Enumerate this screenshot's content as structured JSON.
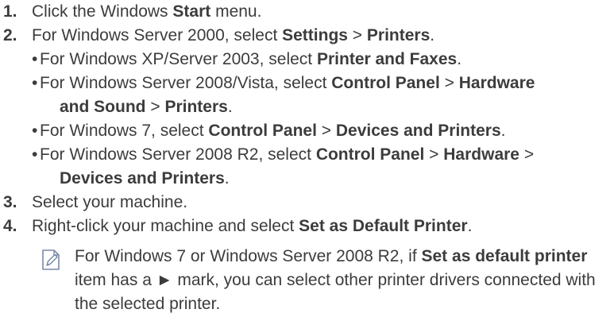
{
  "steps": [
    {
      "num": "1.",
      "parts": [
        "Click the Windows ",
        "Start",
        " menu."
      ]
    },
    {
      "num": "2.",
      "parts": [
        "For Windows Server 2000, select ",
        "Settings",
        " > ",
        "Printers",
        "."
      ],
      "subs": [
        {
          "bullet": "•",
          "parts": [
            "For Windows XP/Server 2003, select ",
            "Printer and Faxes",
            "."
          ]
        },
        {
          "bullet": "•",
          "parts": [
            "For Windows Server 2008/Vista, select ",
            "Control Panel",
            " > ",
            "Hardware",
            "and Sound",
            " > ",
            "Printers",
            "."
          ]
        },
        {
          "bullet": "•",
          "parts": [
            "For Windows 7, select ",
            "Control Panel",
            " > ",
            "Devices and Printers",
            "."
          ]
        },
        {
          "bullet": "•",
          "parts": [
            "For Windows Server 2008 R2, select ",
            "Control Panel",
            " > ",
            "Hardware",
            " >",
            "Devices and Printers",
            "."
          ]
        }
      ]
    },
    {
      "num": "3.",
      "parts": [
        "Select your machine."
      ]
    },
    {
      "num": "4.",
      "parts": [
        "Right-click your machine and select ",
        "Set as Default Printer",
        "."
      ]
    }
  ],
  "note": {
    "icon": "note-pencil-icon",
    "parts": [
      "For Windows 7 or Windows Server 2008 R2, if ",
      "Set as default printer",
      " item has a ► mark, you can select other printer drivers connected with the selected printer."
    ]
  }
}
